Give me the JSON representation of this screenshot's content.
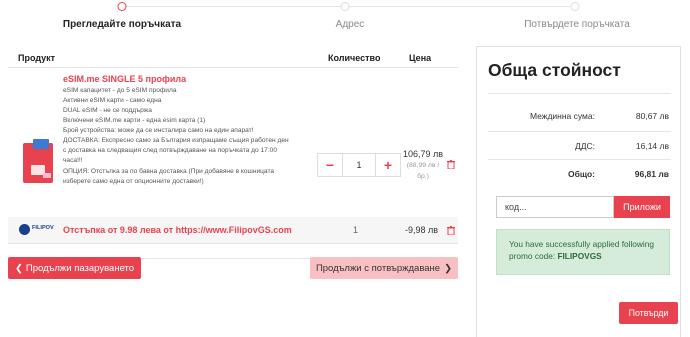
{
  "steps": [
    "Прегледайте поръчката",
    "Адрес",
    "Потвърдете поръчката"
  ],
  "cart": {
    "headers": {
      "product": "Продукт",
      "quantity": "Количество",
      "price": "Цена"
    },
    "item": {
      "title": "eSIM.me SINGLE 5 профила",
      "lines": [
        "eSIM капацитет - до 5 eSIM профила",
        "Активни eSIM карти - само една",
        "DUAL eSIM - не се поддържа",
        "Включени eSIM.me карти - една esim карта (1)",
        "Брой устройства: може да се инсталира само на един апарат!",
        "ДОСТАВКА: Експресно само за България изпращаме същия работен ден",
        "с доставка на следващия след потвърждаване на поръчката до 17:00",
        "часа!!!",
        "ОПЦИЯ: Отстъпка за по бавна доставка (При добавяне в кошницата",
        "изберете само една от опционните доставки!)"
      ],
      "qty": "1",
      "minus": "−",
      "plus": "+",
      "price": "106,79 лв",
      "unit_price": "(88,99 лв /",
      "unit_suffix": "бр.)"
    },
    "discount": {
      "logo_text": "FILIPOV",
      "title": "Отстъпка от 9.98 лева от https://www.FilipovGS.com",
      "qty": "1",
      "price": "-9,98 лв"
    },
    "continue_label": "Продължи пазаруването",
    "checkout_label": "Продължи с потвърждаване"
  },
  "summary": {
    "title": "Обща стойност",
    "subtotal_label": "Междинна сума:",
    "subtotal": "80,67 лв",
    "vat_label": "ДДС:",
    "vat": "16,14 лв",
    "total_label": "Общо:",
    "total": "96,81 лв",
    "promo_value": "код...",
    "apply_label": "Приложи",
    "alert_text": "You have successfully applied following promo code:",
    "promo_code": "FILIPOVGS",
    "confirm_label": "Потвърди"
  }
}
